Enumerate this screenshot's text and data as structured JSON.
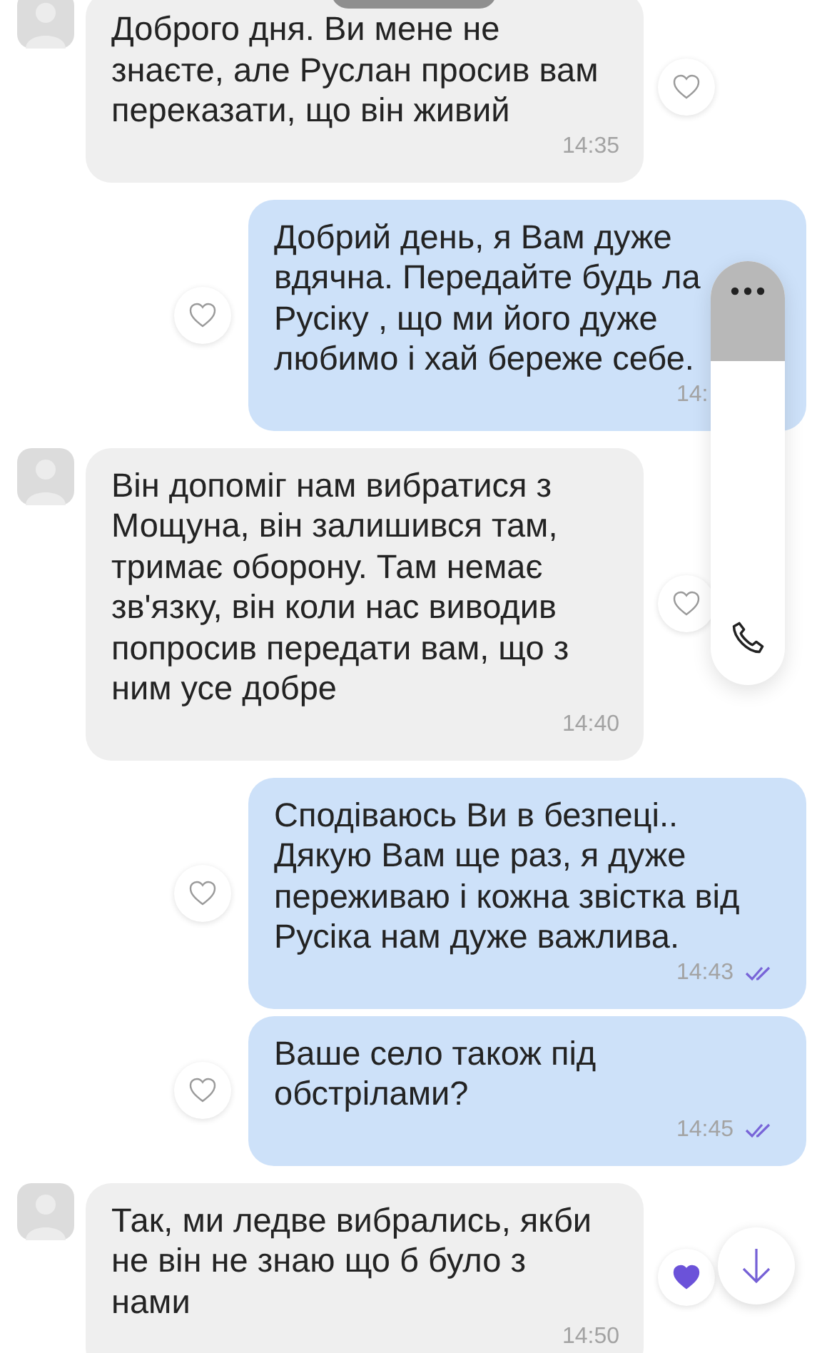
{
  "messages": [
    {
      "kind": "incoming",
      "text": "Доброго дня. Ви мене не знаєте, але Руслан просив вам переказати, що він живий",
      "time": "14:35",
      "liked": false
    },
    {
      "kind": "outgoing",
      "text": "Добрий день, я Вам дуже вдячна. Передайте будь ла",
      "text_2": "Русіку , що ми його дуже любимо і хай береже себе.",
      "time": "14:",
      "liked": false
    },
    {
      "kind": "incoming",
      "text": "Він допоміг нам вибратися з Мощуна, він залишився там, тримає оборону. Там немає зв'язку, він коли нас виводив попросив передати вам, що з ним усе добре",
      "time": "14:40",
      "liked": false
    },
    {
      "kind": "outgoing",
      "text": "Сподіваюсь Ви в безпеці.. Дякую Вам ще раз, я дуже переживаю і кожна звістка від Русіка нам дуже важлива.",
      "time": "14:43",
      "read": true,
      "liked": false
    },
    {
      "kind": "outgoing",
      "text": "Ваше село також під обстрілами?",
      "time": "14:45",
      "read": true,
      "liked": false
    },
    {
      "kind": "incoming",
      "text": "Так, ми ледве вибрались, якби не він не знаю що б було з нами",
      "time": "14:50",
      "liked": true
    }
  ]
}
